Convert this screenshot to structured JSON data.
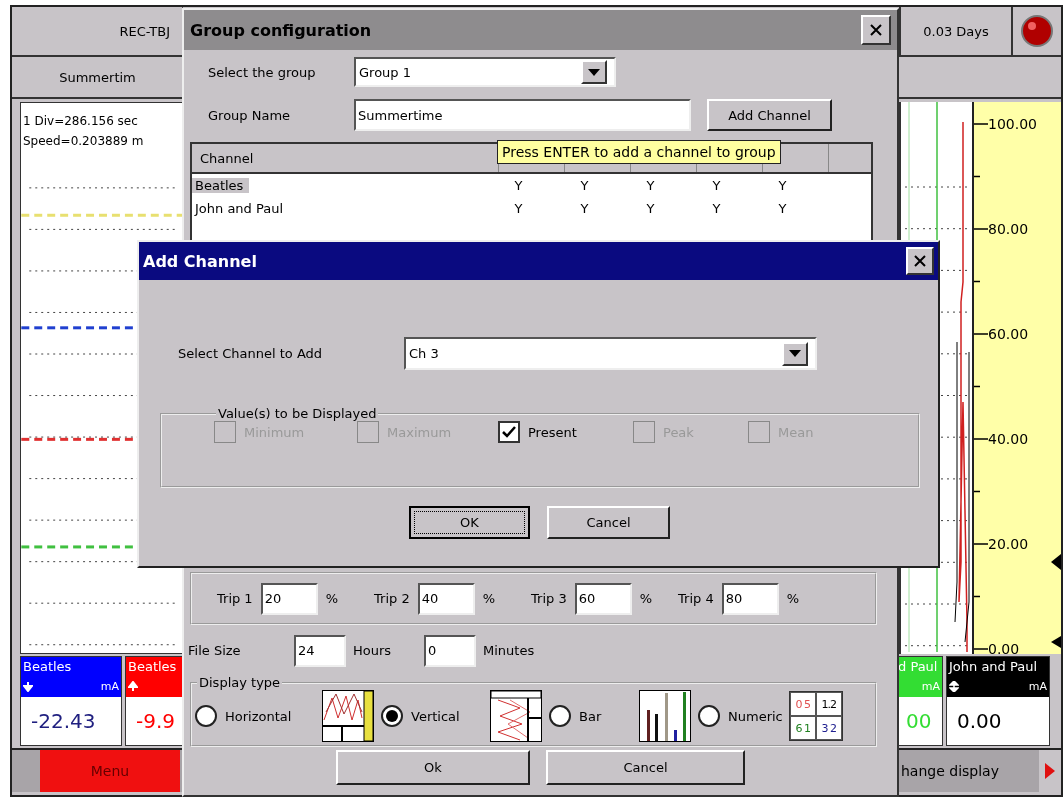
{
  "recorder": {
    "name": "REC-TBJ",
    "duration": "0.03 Days",
    "group_tab": "Summertim",
    "chart_info": [
      "1 Div=286.156 sec",
      "Speed=0.203889 m"
    ],
    "trip_lines": [
      {
        "color": "#e8e070"
      },
      {
        "color": "#2040d0"
      },
      {
        "color": "#e03030"
      },
      {
        "color": "#40c040"
      }
    ],
    "scale_labels": [
      "100.00",
      "80.00",
      "60.00",
      "40.00",
      "20.00",
      "0.00"
    ],
    "left_channels": [
      {
        "name": "Beatles",
        "unit": "mA",
        "arrow_down": true,
        "value": "-22.43",
        "color": "#0000ff"
      },
      {
        "name": "Beatles",
        "arrow_up": true,
        "value": "-9.9",
        "color": "#ff0000"
      }
    ],
    "right_channels": [
      {
        "name": "d Paul",
        "unit": "mA",
        "value": "00",
        "color": "#33dd33"
      },
      {
        "name": "John and Paul",
        "unit": "mA",
        "arrow_up": true,
        "arrow_down": true,
        "value": "0.00",
        "color": "#000000"
      }
    ],
    "menu_button": "Menu",
    "change_display_button": "hange display"
  },
  "group_configuration": {
    "title": "Group configuration",
    "select_group": {
      "label": "Select the group",
      "value": "Group 1"
    },
    "group_name": {
      "label": "Group Name",
      "value": "Summertime"
    },
    "add_channel_button": "Add Channel",
    "tooltip": "Press ENTER to add a channel to group",
    "table": {
      "columns": [
        "Channel"
      ],
      "rows": [
        {
          "channel": "Beatles",
          "values": [
            "Y",
            "Y",
            "Y",
            "Y",
            "Y"
          ],
          "selected": true
        },
        {
          "channel": "John and Paul",
          "values": [
            "Y",
            "Y",
            "Y",
            "Y",
            "Y"
          ],
          "selected": false
        }
      ]
    },
    "trip_lines": [
      {
        "label": "Trip 1",
        "value": "20",
        "unit": "%"
      },
      {
        "label": "Trip 2",
        "value": "40",
        "unit": "%"
      },
      {
        "label": "Trip 3",
        "value": "60",
        "unit": "%"
      },
      {
        "label": "Trip 4",
        "value": "80",
        "unit": "%"
      }
    ],
    "file_size": {
      "label": "File Size",
      "hours": "24",
      "hours_label": "Hours",
      "minutes": "0",
      "minutes_label": "Minutes"
    },
    "display_type": {
      "label": "Display type",
      "options": [
        {
          "kind": "horizontal",
          "label": "Horizontal",
          "selected": false
        },
        {
          "kind": "vertical",
          "label": "Vertical",
          "selected": true
        },
        {
          "kind": "bar",
          "label": "Bar",
          "selected": false
        },
        {
          "kind": "numeric",
          "label": "Numeric",
          "selected": false,
          "preview": [
            {
              "text": "0 5",
              "color": "#e05050"
            },
            {
              "text": "1.2",
              "color": "#000000"
            },
            {
              "text": "6 1",
              "color": "#208020"
            },
            {
              "text": "3 2",
              "color": "#202090"
            }
          ]
        }
      ]
    },
    "buttons": [
      "Ok",
      "Cancel"
    ]
  },
  "add_channel": {
    "title": "Add Channel",
    "select_channel": {
      "label": "Select Channel to Add",
      "value": "Ch 3"
    },
    "values_group": {
      "label": "Value(s) to be Displayed",
      "options": [
        {
          "label": "Minimum",
          "checked": false,
          "disabled": true
        },
        {
          "label": "Maximum",
          "checked": false,
          "disabled": true
        },
        {
          "label": "Present",
          "checked": true,
          "disabled": false
        },
        {
          "label": "Peak",
          "checked": false,
          "disabled": true
        },
        {
          "label": "Mean",
          "checked": false,
          "disabled": true
        }
      ]
    },
    "buttons": [
      {
        "label": "OK",
        "focused": true
      },
      {
        "label": "Cancel",
        "focused": false
      }
    ]
  }
}
